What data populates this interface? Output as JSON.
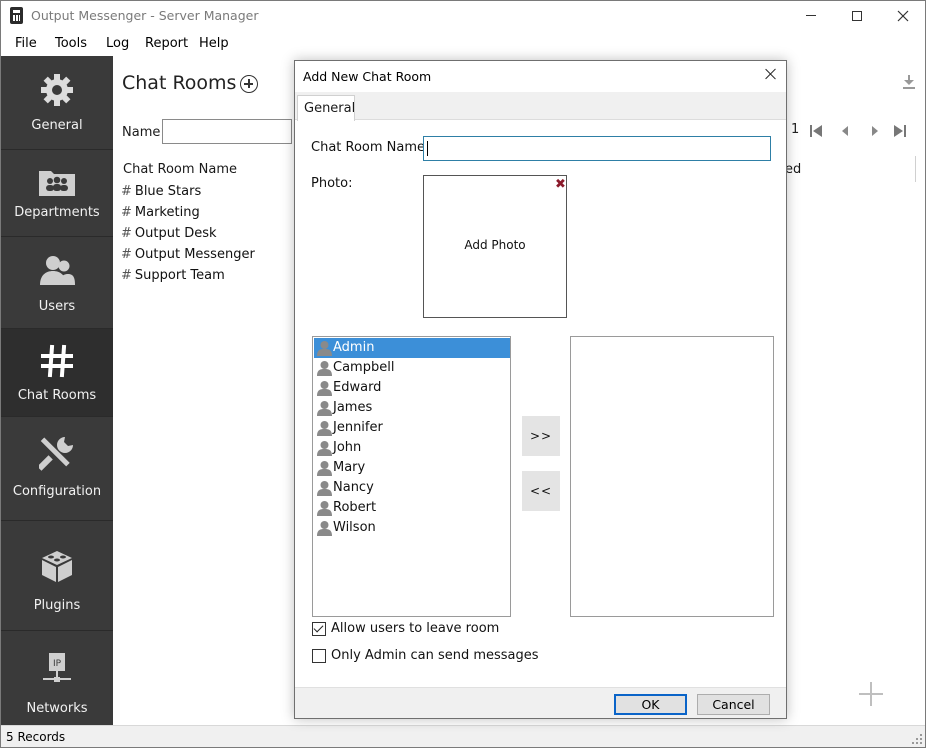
{
  "window": {
    "title": "Output Messenger - Server Manager"
  },
  "menu": [
    "File",
    "Tools",
    "Log",
    "Report",
    "Help"
  ],
  "sidebar": {
    "items": [
      {
        "label": "General",
        "icon": "gear-icon"
      },
      {
        "label": "Departments",
        "icon": "departments-icon"
      },
      {
        "label": "Users",
        "icon": "users-icon"
      },
      {
        "label": "Chat Rooms",
        "icon": "hash-icon",
        "active": true
      },
      {
        "label": "Configuration",
        "icon": "tools-icon"
      },
      {
        "label": "Plugins",
        "icon": "plugins-icon"
      },
      {
        "label": "Networks",
        "icon": "network-icon"
      }
    ]
  },
  "main": {
    "title": "Chat Rooms",
    "name_filter_label": "Name",
    "name_filter_value": "",
    "column_header": "Chat Room Name",
    "partial_column_text": "ed",
    "page_number": "1",
    "rooms": [
      "Blue Stars",
      "Marketing",
      "Output Desk",
      "Output Messenger",
      "Support Team"
    ]
  },
  "status": {
    "records": "5 Records"
  },
  "dialog": {
    "title": "Add New Chat Room",
    "tab": "General",
    "room_name_label": "Chat Room Name",
    "room_name_value": "",
    "photo_label": "Photo:",
    "add_photo": "Add Photo",
    "remove_photo_glyph": "✖",
    "users": [
      "Admin",
      "Campbell",
      "Edward",
      "James",
      "Jennifer",
      "John",
      "Mary",
      "Nancy",
      "Robert",
      "Wilson"
    ],
    "selected_user": "Admin",
    "selected_members": [],
    "add_button": ">>",
    "remove_button": "<<",
    "allow_leave_label": "Allow users to leave room",
    "allow_leave_checked": true,
    "admin_only_label": "Only Admin can send messages",
    "admin_only_checked": false,
    "ok_label": "OK",
    "cancel_label": "Cancel"
  }
}
